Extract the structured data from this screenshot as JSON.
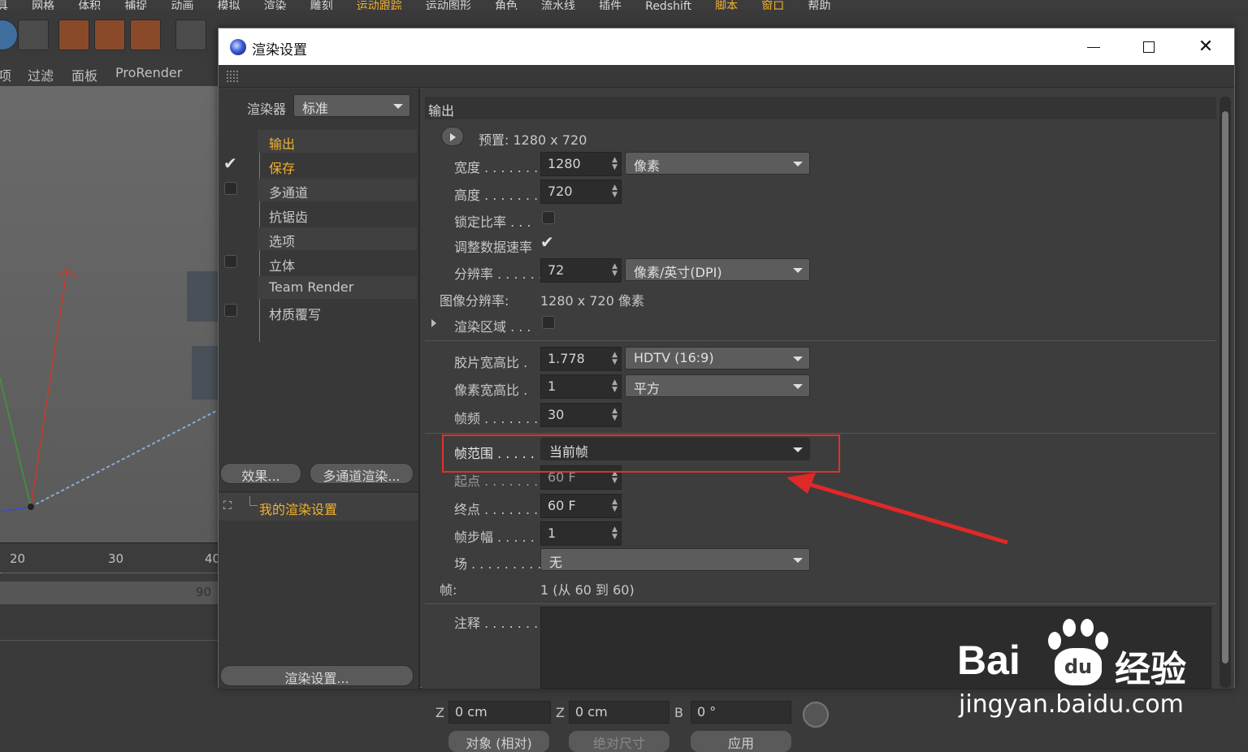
{
  "background": {
    "menu_items": [
      "具",
      "网格",
      "体积",
      "捕捉",
      "动画",
      "模拟",
      "渲染",
      "雕刻",
      "运动跟踪",
      "运动图形",
      "角色",
      "流水线",
      "插件",
      "Redshift",
      "脚本",
      "窗口",
      "帮助"
    ],
    "panel_tabs": [
      "项",
      "过滤",
      "面板",
      "ProRender"
    ],
    "timeline_ticks": [
      "20",
      "30",
      "40"
    ],
    "timebar_value": "90",
    "coord": {
      "z_label": "Z",
      "z_value": "0 cm",
      "z2_label": "Z",
      "z2_value": "0 cm",
      "b_label": "B",
      "b_value": "0 °",
      "mode_select": "对象 (相对)",
      "size_select": "绝对尺寸",
      "apply_button": "应用"
    }
  },
  "dialog": {
    "title": "渲染设置",
    "renderer_label": "渲染器",
    "renderer_value": "标准",
    "tree": [
      {
        "label": "输出",
        "checked": null,
        "selected": true
      },
      {
        "label": "保存",
        "checked": true,
        "selected": false
      },
      {
        "label": "多通道",
        "checked": false,
        "selected": false
      },
      {
        "label": "抗锯齿",
        "checked": null,
        "selected": false
      },
      {
        "label": "选项",
        "checked": null,
        "selected": false
      },
      {
        "label": "立体",
        "checked": false,
        "selected": false
      },
      {
        "label": "Team Render",
        "checked": null,
        "selected": false
      },
      {
        "label": "材质覆写",
        "checked": false,
        "selected": false
      }
    ],
    "effects_button": "效果...",
    "multipass_button": "多通道渲染...",
    "my_settings": "我的渲染设置",
    "render_settings_button": "渲染设置...",
    "section_title": "输出",
    "preset": "预置: 1280 x 720",
    "width_label": "宽度 . . . . . . .",
    "width_value": "1280",
    "unit_select": "像素",
    "height_label": "高度 . . . . . . .",
    "height_value": "720",
    "lock_ratio_label": "锁定比率 . . .",
    "adjust_rate_label": "调整数据速率",
    "resolution_label": "分辨率 . . . . . .",
    "resolution_value": "72",
    "resolution_unit": "像素/英寸(DPI)",
    "image_res_label": "图像分辨率:",
    "image_res_value": "1280 x 720 像素",
    "render_region_label": "渲染区域 . . .",
    "film_aspect_label": "胶片宽高比 .",
    "film_aspect_value": "1.778",
    "film_aspect_select": "HDTV (16:9)",
    "pixel_aspect_label": "像素宽高比 .",
    "pixel_aspect_value": "1",
    "pixel_aspect_select": "平方",
    "fps_label": "帧频 . . . . . . .",
    "fps_value": "30",
    "frame_range_label": "帧范围 . . . . .",
    "frame_range_value": "当前帧",
    "start_label": "起点 . . . . . . .",
    "start_value": "60 F",
    "end_label": "终点 . . . . . . .",
    "end_value": "60 F",
    "step_label": "帧步幅 . . . . .",
    "step_value": "1",
    "field_label": "场 . . . . . . . . .",
    "field_value": "无",
    "frames_label": "帧:",
    "frames_value": "1 (从 60 到 60)",
    "notes_label": "注释 . . . . . . ."
  },
  "watermark": {
    "brand": "Bai",
    "brand2": "du",
    "cn": "经验",
    "url": "jingyan.baidu.com"
  },
  "colors": {
    "accent": "#f0b030",
    "highlight_box": "#e03030",
    "arrow": "#e02828"
  }
}
